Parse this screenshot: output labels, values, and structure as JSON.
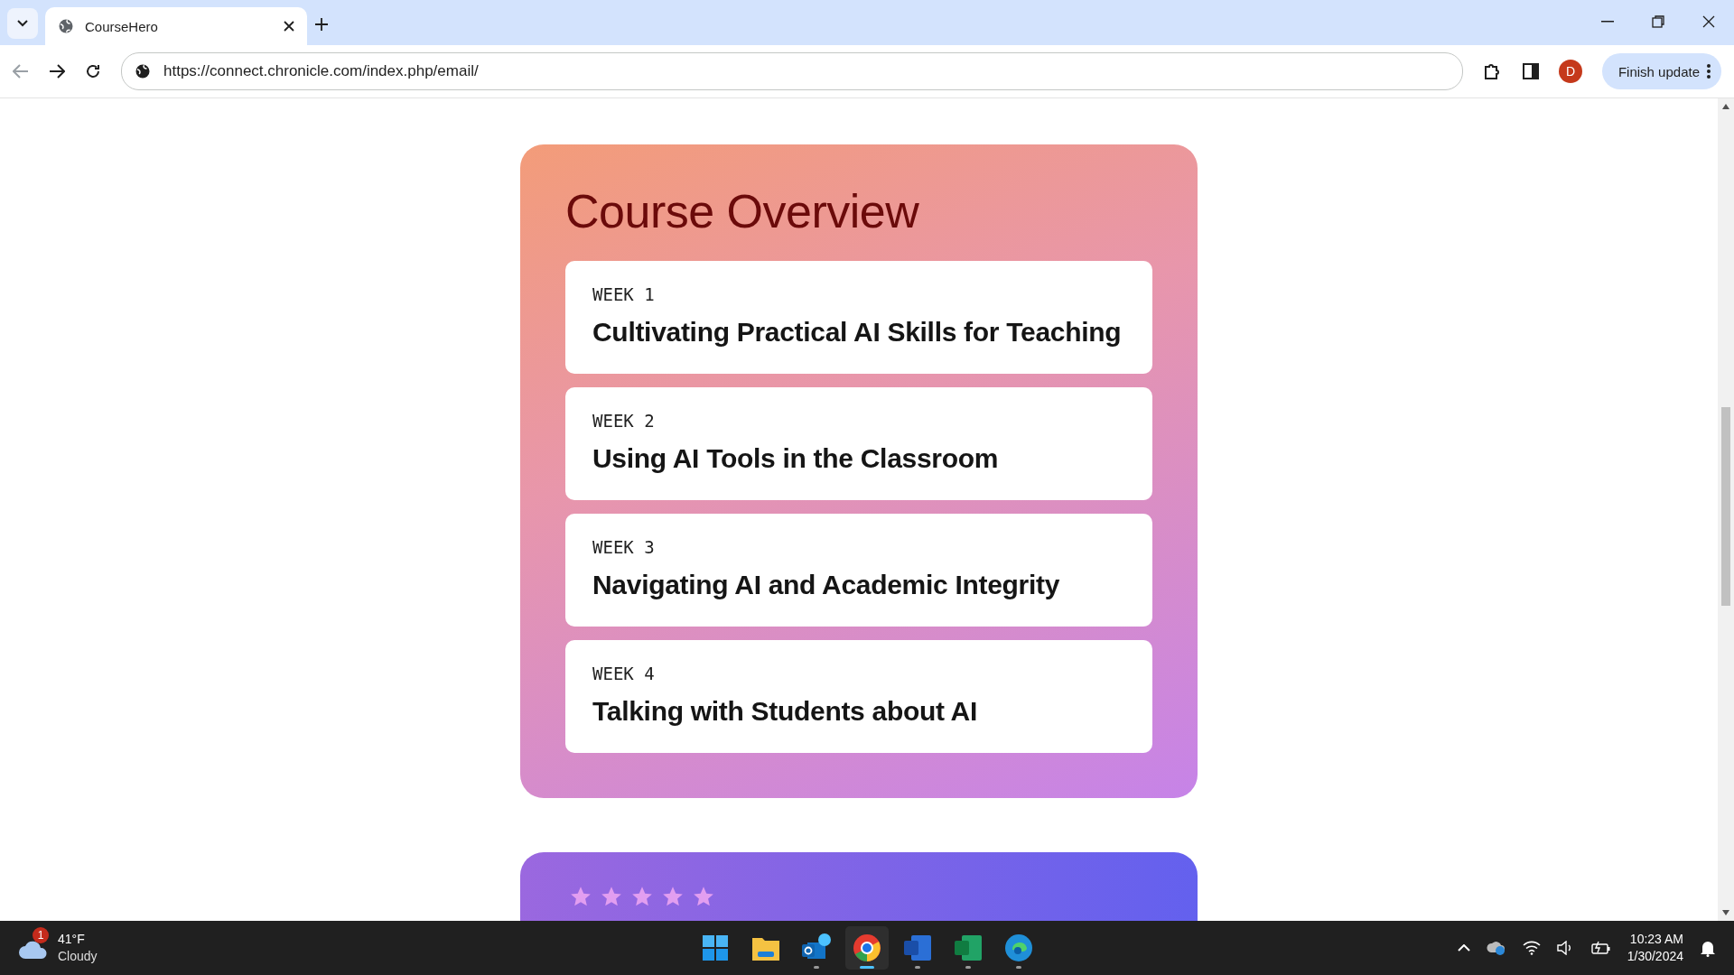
{
  "browser": {
    "tabs": [
      {
        "title": "CourseHero",
        "selected": true
      }
    ],
    "url": "https://connect.chronicle.com/index.php/email/",
    "profile_initial": "D",
    "update_button": "Finish update"
  },
  "course_overview": {
    "title": "Course Overview",
    "weeks": [
      {
        "label": "WEEK 1",
        "title": "Cultivating Practical AI Skills for Teaching"
      },
      {
        "label": "WEEK 2",
        "title": "Using AI Tools in the Classroom"
      },
      {
        "label": "WEEK 3",
        "title": "Navigating AI and Academic Integrity"
      },
      {
        "label": "WEEK 4",
        "title": "Talking with Students about AI"
      }
    ]
  },
  "review_card": {
    "stars": 5
  },
  "taskbar": {
    "weather": {
      "temperature": "41°F",
      "condition": "Cloudy",
      "badge": "1"
    },
    "apps": [
      {
        "kind": "start",
        "running": false,
        "selected": false
      },
      {
        "kind": "files",
        "running": false,
        "selected": false
      },
      {
        "kind": "mail",
        "running": true,
        "selected": false
      },
      {
        "kind": "browser",
        "running": true,
        "selected": true
      },
      {
        "kind": "word",
        "running": true,
        "selected": false
      },
      {
        "kind": "excel",
        "running": true,
        "selected": false
      },
      {
        "kind": "edge",
        "running": true,
        "selected": false
      }
    ],
    "time": "10:23 AM",
    "date": "1/30/2024"
  }
}
